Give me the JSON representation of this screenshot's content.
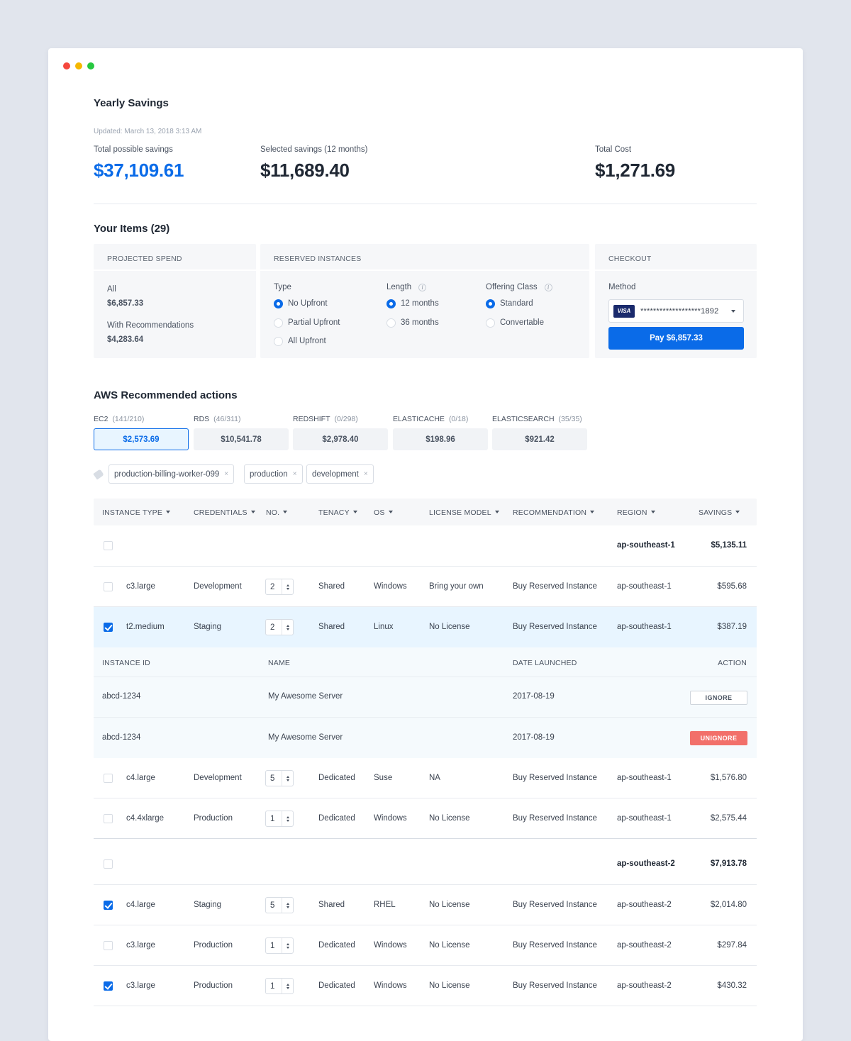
{
  "summary": {
    "title": "Yearly Savings",
    "updated": "Updated: March 13, 2018 3:13 AM",
    "total_possible_label": "Total possible savings",
    "total_possible_value": "$37,109.61",
    "selected_label": "Selected savings (12 months)",
    "selected_value": "$11,689.40",
    "total_cost_label": "Total Cost",
    "total_cost_value": "$1,271.69"
  },
  "items": {
    "title": "Your Items (29)",
    "projected": {
      "header": "PROJECTED SPEND",
      "all_label": "All",
      "all_value": "$6,857.33",
      "rec_label": "With Recommendations",
      "rec_value": "$4,283.64"
    },
    "reserved": {
      "header": "RESERVED INSTANCES",
      "type_label": "Type",
      "type_options": [
        "No Upfront",
        "Partial Upfront",
        "All Upfront"
      ],
      "length_label": "Length",
      "length_options": [
        "12 months",
        "36 months"
      ],
      "offering_label": "Offering Class",
      "offering_options": [
        "Standard",
        "Convertable"
      ]
    },
    "checkout": {
      "header": "CHECKOUT",
      "method_label": "Method",
      "card_brand": "VISA",
      "card_number": "*******************1892",
      "pay_label": "Pay $6,857.33"
    }
  },
  "aws": {
    "title": "AWS Recommended actions",
    "services": [
      {
        "name": "EC2",
        "count": "(141/210)",
        "value": "$2,573.69"
      },
      {
        "name": "RDS",
        "count": "(46/311)",
        "value": "$10,541.78"
      },
      {
        "name": "REDSHIFT",
        "count": "(0/298)",
        "value": "$2,978.40"
      },
      {
        "name": "ELASTICACHE",
        "count": "(0/18)",
        "value": "$198.96"
      },
      {
        "name": "ELASTICSEARCH",
        "count": "(35/35)",
        "value": "$921.42"
      }
    ],
    "tags": [
      "production-billing-worker-099",
      "production",
      "development"
    ],
    "remove_glyph": "×"
  },
  "table": {
    "columns": [
      "INSTANCE TYPE",
      "CREDENTIALS",
      "NO.",
      "TENACY",
      "OS",
      "LICENSE MODEL",
      "RECOMMENDATION",
      "REGION",
      "SAVINGS"
    ],
    "group1": {
      "region": "ap-southeast-1",
      "savings": "$5,135.11"
    },
    "rows1": [
      {
        "type": "c3.large",
        "cred": "Development",
        "no": "2",
        "tenancy": "Shared",
        "os": "Windows",
        "license": "Bring your own",
        "rec": "Buy Reserved Instance",
        "region": "ap-southeast-1",
        "savings": "$595.68"
      },
      {
        "type": "t2.medium",
        "cred": "Staging",
        "no": "2",
        "tenancy": "Shared",
        "os": "Linux",
        "license": "No License",
        "rec": "Buy Reserved Instance",
        "region": "ap-southeast-1",
        "savings": "$387.19"
      }
    ],
    "sub": {
      "columns": [
        "INSTANCE ID",
        "NAME",
        "DATE LAUNCHED",
        "ACTION"
      ],
      "rows": [
        {
          "id": "abcd-1234",
          "name": "My Awesome Server",
          "date": "2017-08-19",
          "action": "IGNORE"
        },
        {
          "id": "abcd-1234",
          "name": "My Awesome Server",
          "date": "2017-08-19",
          "action": "UNIGNORE"
        }
      ]
    },
    "rows1b": [
      {
        "type": "c4.large",
        "cred": "Development",
        "no": "5",
        "tenancy": "Dedicated",
        "os": "Suse",
        "license": "NA",
        "rec": "Buy Reserved Instance",
        "region": "ap-southeast-1",
        "savings": "$1,576.80"
      },
      {
        "type": "c4.4xlarge",
        "cred": "Production",
        "no": "1",
        "tenancy": "Dedicated",
        "os": "Windows",
        "license": "No License",
        "rec": "Buy Reserved Instance",
        "region": "ap-southeast-1",
        "savings": "$2,575.44"
      }
    ],
    "group2": {
      "region": "ap-southeast-2",
      "savings": "$7,913.78"
    },
    "rows2": [
      {
        "type": "c4.large",
        "cred": "Staging",
        "no": "5",
        "tenancy": "Shared",
        "os": "RHEL",
        "license": "No License",
        "rec": "Buy Reserved Instance",
        "region": "ap-southeast-2",
        "savings": "$2,014.80"
      },
      {
        "type": "c3.large",
        "cred": "Production",
        "no": "1",
        "tenancy": "Dedicated",
        "os": "Windows",
        "license": "No License",
        "rec": "Buy Reserved Instance",
        "region": "ap-southeast-2",
        "savings": "$297.84"
      },
      {
        "type": "c3.large",
        "cred": "Production",
        "no": "1",
        "tenancy": "Dedicated",
        "os": "Windows",
        "license": "No License",
        "rec": "Buy Reserved Instance",
        "region": "ap-southeast-2",
        "savings": "$430.32"
      }
    ]
  }
}
